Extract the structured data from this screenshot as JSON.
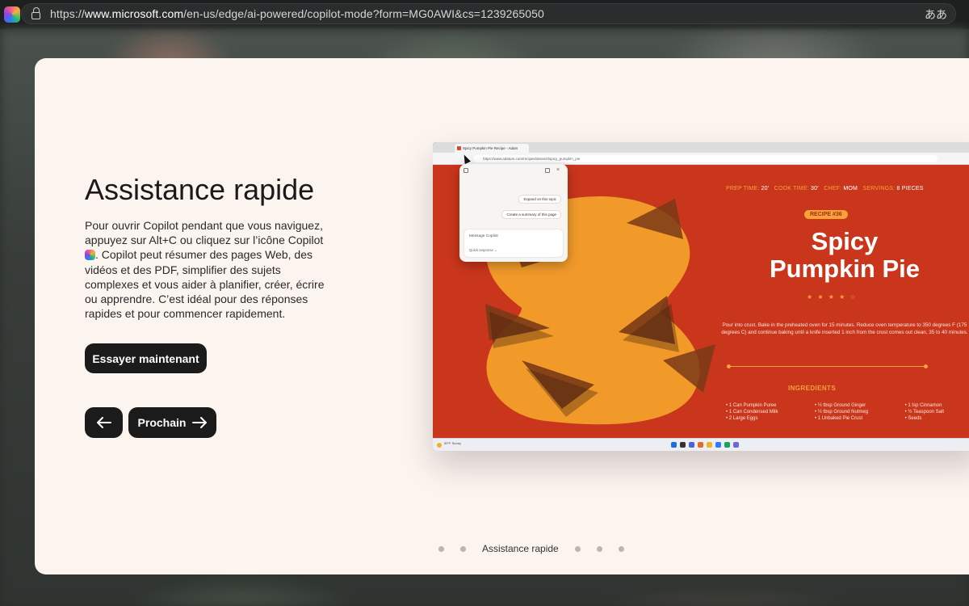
{
  "browser": {
    "url_prefix": "https://",
    "url_domain": "www.microsoft.com",
    "url_path": "/en-us/edge/ai-powered/copilot-mode?form=MG0AWI&cs=1239265050",
    "translate_label": "ああ",
    "icons": [
      "copilot-app-icon",
      "lock-icon",
      "translate-icon"
    ]
  },
  "hero": {
    "title": "Assistance rapide",
    "description_part1": "Pour ouvrir Copilot pendant que vous naviguez, appuyez sur Alt+C ou cliquez sur l’icône Copilot ",
    "description_part2": ". Copilot peut résumer des pages Web, des vidéos et des PDF, simplifier des sujets complexes et vous aider à planifier, créer, écrire ou apprendre. C’est idéal pour des réponses rapides et pour commencer rapidement.",
    "try_button": "Essayer maintenant",
    "prev_button": "←",
    "next_button": "Prochain",
    "next_arrow": "→"
  },
  "pagination": {
    "active_label": "Assistance rapide",
    "dots_before": 2,
    "dots_after": 3
  },
  "screenshot": {
    "tab_title": "Spicy Pumpkin Pie Recipe - Adam",
    "url": "https://www.adatum.com/recipes/dessert/spicy_pumpkin_pie",
    "stats": [
      {
        "key": "PREP TIME:",
        "value": "20'"
      },
      {
        "key": "COOK TIME:",
        "value": "30'"
      },
      {
        "key": "CHEF:",
        "value": "MOM"
      },
      {
        "key": "SERVINGS:",
        "value": "8 PIECES"
      }
    ],
    "badge": "RECIPE #36",
    "recipe_title_line1": "Spicy",
    "recipe_title_line2": "Pumpkin Pie",
    "rating": 4,
    "stars": "★ ★ ★ ★ ☆",
    "instructions": "Pour into crust. Bake in the preheated oven for 15 minutes. Reduce oven temperature to 350 degrees F (175 degrees C) and continue baking until a knife inserted 1 inch from the crust comes out clean, 35 to 40 minutes.",
    "ingredients_heading": "INGREDIENTS",
    "ingredients": [
      [
        "• 1 Can Pumpkin Puree",
        "• 1 Can Condensed Milk",
        "• 2 Large Eggs"
      ],
      [
        "• ½ tbsp Ground Ginger",
        "• ½ tbsp Ground Nutmeg",
        "• 1 Unbaked Pie Crust"
      ],
      [
        "• 1 tsp Cinnamon",
        "• ½ Teaspoon Salt",
        "• Seeds"
      ]
    ],
    "popup": {
      "chip1": "Expand on this topic",
      "chip2": "Create a summary of this page",
      "input_placeholder": "Message Copilot",
      "mode": "Quick response ⌄"
    },
    "weather": "59°F Sunny",
    "taskbar_colors": [
      "#1f6fd6",
      "#333333",
      "#4a63d8",
      "#e06b2b",
      "#f0b323",
      "#2f7bf5",
      "#1aa260",
      "#6b6bd6"
    ],
    "colors": {
      "page": "#c9361b",
      "accent": "#f7a23b",
      "blob": "#f19a2a"
    }
  }
}
